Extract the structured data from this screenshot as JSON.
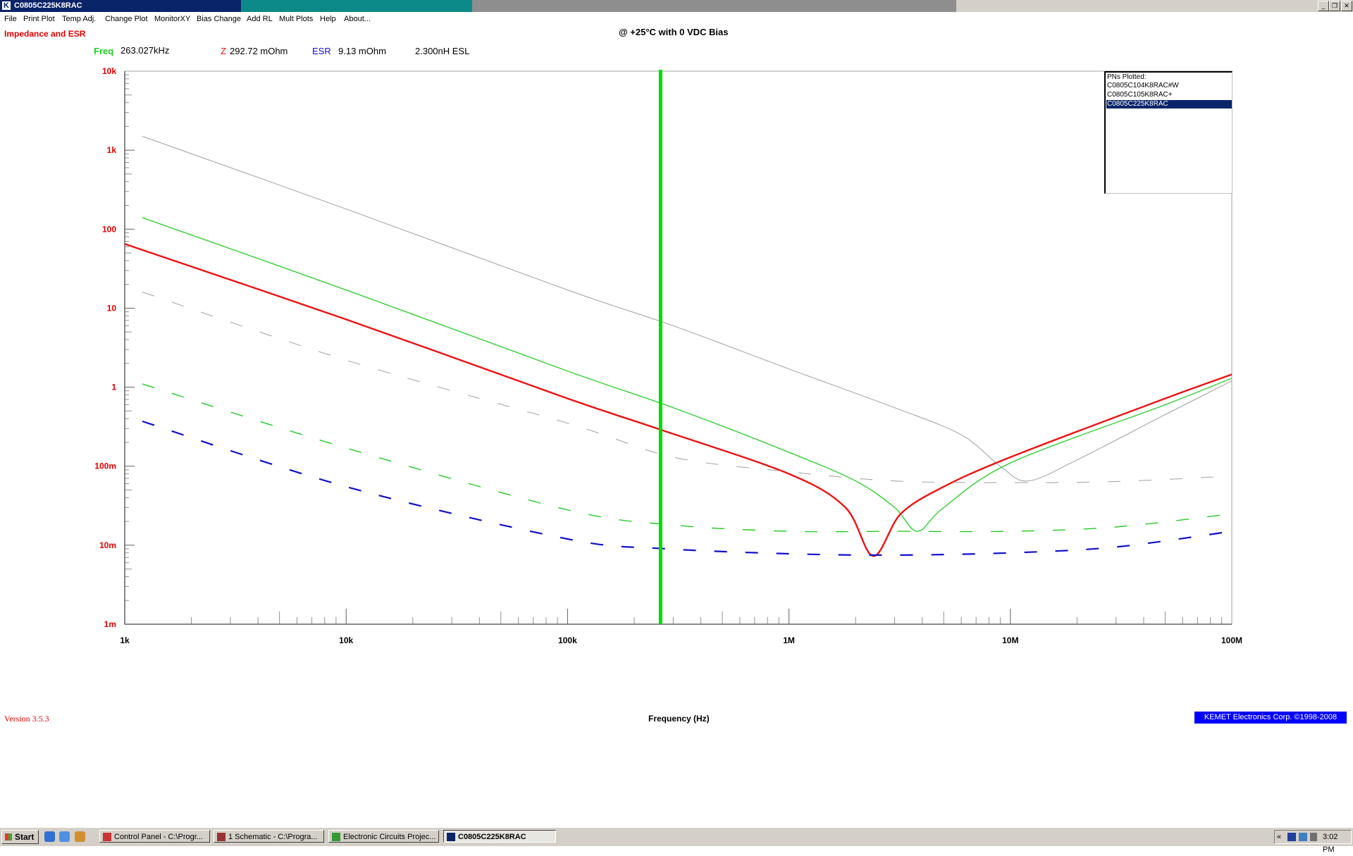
{
  "window": {
    "title": "C0805C225K8RAC",
    "app_icon": "K",
    "controls": [
      "minimize-icon",
      "restore-icon",
      "close-icon"
    ]
  },
  "menu": [
    "File",
    "Print Plot",
    "Temp Adj.",
    "Change Plot",
    "MonitorXY",
    "Bias Change",
    "Add RL",
    "Mult Plots",
    "Help",
    "About..."
  ],
  "header": {
    "plot_title": "Impedance and ESR",
    "condition": "@ +25°C with 0 VDC Bias"
  },
  "readout": {
    "freq_label": "Freq",
    "freq_value": "263.027kHz",
    "z_label": "Z",
    "z_value": "292.72 mOhm",
    "esr_label": "ESR",
    "esr_value": "9.13 mOhm",
    "esl_value": "2.300nH ESL"
  },
  "legend": {
    "title": "PNs Plotted:",
    "items": [
      "C0805C104K8RAC#W",
      "C0805C105K8RAC+",
      "C0805C225K8RAC"
    ],
    "selected_index": 2
  },
  "colors": {
    "series_0": "#a0a0a0",
    "series_1": "#22cc22",
    "series_2": "#ee1111",
    "esr_selected": "#1010cc",
    "cursor": "#00dd00",
    "axis_label": "#e00000"
  },
  "chart_data": {
    "type": "line",
    "x_scale": "log",
    "y_scale": "log",
    "xlim": [
      1000,
      100000000
    ],
    "ylim": [
      0.001,
      10000
    ],
    "xlabel": "Frequency (Hz)",
    "x_tick_labels": [
      "1k",
      "10k",
      "100k",
      "1M",
      "10M",
      "100M"
    ],
    "y_tick_labels": [
      "10k",
      "1k",
      "100",
      "10",
      "1",
      "100m",
      "10m",
      "1m"
    ],
    "cursor_x": 263027,
    "legend_position": "top-right",
    "series": [
      {
        "name": "C0805C104K8RAC#W",
        "metric": "Z",
        "style": "solid",
        "x": [
          1200,
          10000,
          100000,
          300000,
          1000000,
          3000000,
          6000000,
          9000000,
          12000000,
          20000000,
          50000000,
          100000000
        ],
        "y": [
          1500,
          180,
          17,
          6,
          1.7,
          0.55,
          0.25,
          0.1,
          0.065,
          0.12,
          0.45,
          1.2
        ]
      },
      {
        "name": "C0805C105K8RAC+",
        "metric": "Z",
        "style": "solid",
        "x": [
          1200,
          10000,
          100000,
          300000,
          1000000,
          2000000,
          3000000,
          3800000,
          5000000,
          10000000,
          50000000,
          100000000
        ],
        "y": [
          140,
          17,
          1.6,
          0.55,
          0.15,
          0.065,
          0.03,
          0.015,
          0.03,
          0.11,
          0.6,
          1.3
        ]
      },
      {
        "name": "C0805C225K8RAC",
        "metric": "Z",
        "style": "solid",
        "x": [
          1000,
          10000,
          100000,
          263027,
          1000000,
          1800000,
          2400000,
          3200000,
          5000000,
          10000000,
          50000000,
          100000000
        ],
        "y": [
          65,
          7.2,
          0.72,
          0.29,
          0.08,
          0.03,
          0.0073,
          0.025,
          0.055,
          0.13,
          0.72,
          1.45
        ]
      },
      {
        "name": "C0805C104K8RAC#W",
        "metric": "ESR",
        "style": "dashed",
        "x": [
          1200,
          10000,
          100000,
          300000,
          1000000,
          3000000,
          10000000,
          30000000,
          100000000
        ],
        "y": [
          16,
          2.2,
          0.35,
          0.13,
          0.085,
          0.065,
          0.062,
          0.064,
          0.075
        ]
      },
      {
        "name": "C0805C105K8RAC+",
        "metric": "ESR",
        "style": "dashed",
        "x": [
          1200,
          10000,
          100000,
          300000,
          1000000,
          3000000,
          10000000,
          30000000,
          100000000
        ],
        "y": [
          1.1,
          0.17,
          0.028,
          0.018,
          0.015,
          0.015,
          0.015,
          0.017,
          0.025
        ]
      },
      {
        "name": "C0805C225K8RAC",
        "metric": "ESR",
        "style": "dashed",
        "x": [
          1200,
          10000,
          100000,
          263027,
          1000000,
          3000000,
          10000000,
          30000000,
          100000000
        ],
        "y": [
          0.37,
          0.055,
          0.012,
          0.0091,
          0.0078,
          0.0075,
          0.008,
          0.0095,
          0.015
        ]
      }
    ]
  },
  "footer": {
    "version": "Version 3.5.3",
    "copyright": "KEMET Electronics Corp. ©1998-2008"
  },
  "taskbar": {
    "start": "Start",
    "quick_launch": [
      "ie-icon",
      "desktop-icon",
      "media-icon"
    ],
    "tasks": [
      {
        "label": "Control Panel - C:\\Progr...",
        "icon": "control-panel-icon",
        "active": false
      },
      {
        "label": "1 Schematic - C:\\Progra...",
        "icon": "schematic-icon",
        "active": false
      },
      {
        "label": "Electronic Circuits Projec...",
        "icon": "circuits-icon",
        "active": false
      },
      {
        "label": "C0805C225K8RAC",
        "icon": "kemet-icon",
        "active": true
      }
    ],
    "clock": "3:02 PM"
  }
}
